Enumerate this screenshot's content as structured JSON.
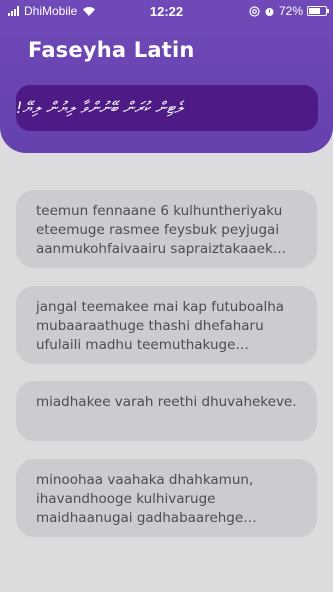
{
  "status_bar": {
    "carrier": "DhiMobile",
    "time": "12:22",
    "battery": "72%",
    "battery_level": 0.72
  },
  "header": {
    "title": "Faseyha Latin",
    "search_value": "ލެޓިން ކުރަން ބޭނުންވާ ލިޔުން ލިޔޭ!"
  },
  "cards": [
    {
      "text": "teemun fennaane 6 kulhuntheriyaku eteemuge rasmee feysbuk peyjugai aanmukohfaivaairu sapraiztakaaek kurumuge fursathu hoadhaafai vanee"
    },
    {
      "text": "jangal teemakee mai kap futuboalha mubaaraathuge thashi dhefaharu ufulaili madhu teemuthakuge thereinun ekeh"
    },
    {
      "text": "miadhakee varah reethi dhuvahekeve."
    },
    {
      "text": "minoohaa vaahaka dhahkamun, ihavandhooge kulhivaruge maidhaanugai gadhabaarehge gothuga mulhi"
    }
  ]
}
